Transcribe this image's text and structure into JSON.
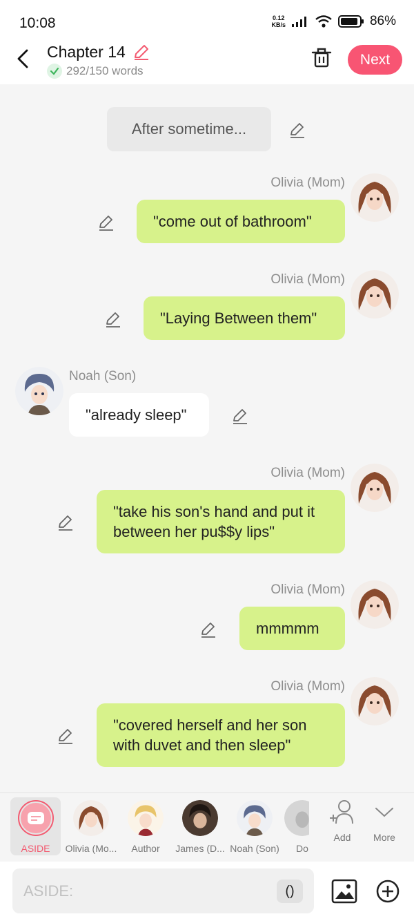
{
  "status": {
    "time": "10:08",
    "net_speed_value": "0.12",
    "net_speed_unit": "KB/s",
    "battery": "86%"
  },
  "header": {
    "title": "Chapter 14",
    "word_count": "292/150 words",
    "next_label": "Next"
  },
  "chat": {
    "aside_text": "After sometime...",
    "messages": [
      {
        "speaker": "Olivia (Mom)",
        "text": "\"come out of bathroom\""
      },
      {
        "speaker": "Olivia (Mom)",
        "text": "\"Laying Between them\""
      },
      {
        "speaker": "Noah (Son)",
        "text": "\"already sleep\""
      },
      {
        "speaker": "Olivia (Mom)",
        "text": "\"take his son's hand and put it between her pu$$y lips\""
      },
      {
        "speaker": "Olivia (Mom)",
        "text": "mmmmm"
      },
      {
        "speaker": "Olivia (Mom)",
        "text": "\"covered herself and her son with duvet and then sleep\""
      }
    ]
  },
  "characters": [
    {
      "label": "ASIDE"
    },
    {
      "label": "Olivia (Mo..."
    },
    {
      "label": "Author"
    },
    {
      "label": "James (D..."
    },
    {
      "label": "Noah (Son)"
    },
    {
      "label": "Do"
    },
    {
      "label": "Add"
    },
    {
      "label": "More"
    }
  ],
  "input": {
    "placeholder": "ASIDE:",
    "paren_label": "()"
  },
  "colors": {
    "accent": "#f85573",
    "bubble_green": "#d7f28b",
    "bubble_white": "#ffffff",
    "background": "#f5f5f5"
  }
}
